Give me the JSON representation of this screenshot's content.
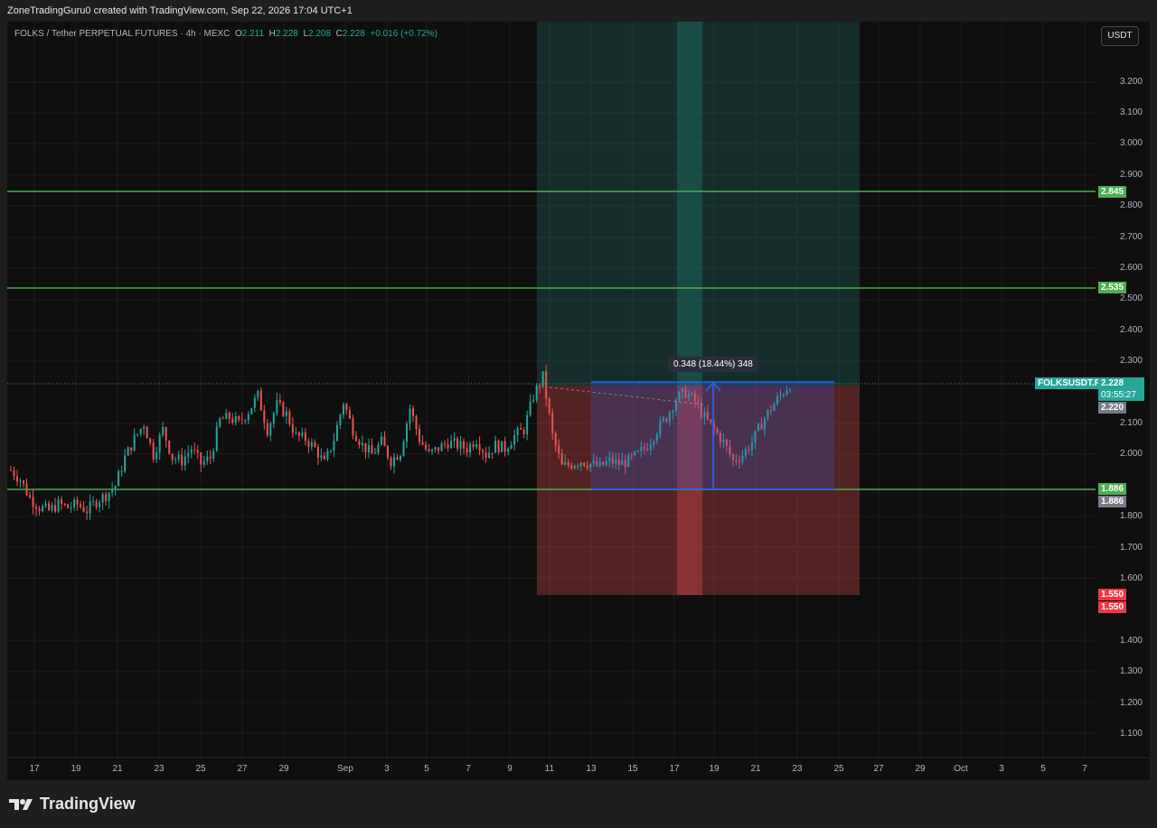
{
  "header": {
    "credit": "ZoneTradingGuru0 created with TradingView.com, Sep 22, 2026 17:04 UTC+1"
  },
  "legend": {
    "symbol": "FOLKS / Tether PERPETUAL FUTURES · 4h · MEXC",
    "o_key": "O",
    "o_val": "2.211",
    "h_key": "H",
    "h_val": "2.228",
    "l_key": "L",
    "l_val": "2.208",
    "c_key": "C",
    "c_val": "2.228",
    "change": "+0.016 (+0.72%)"
  },
  "currency_button": "USDT",
  "price_axis": [
    "3.200",
    "3.100",
    "3.000",
    "2.900",
    "2.800",
    "2.700",
    "2.600",
    "2.500",
    "2.400",
    "2.300",
    "2.100",
    "2.000",
    "1.800",
    "1.700",
    "1.600",
    "1.400",
    "1.300",
    "1.200",
    "1.100"
  ],
  "time_axis": [
    "17",
    "19",
    "21",
    "23",
    "25",
    "27",
    "29",
    "Sep",
    "3",
    "5",
    "7",
    "9",
    "11",
    "13",
    "15",
    "17",
    "19",
    "21",
    "23",
    "25",
    "27",
    "29",
    "Oct",
    "3",
    "5",
    "7"
  ],
  "tags": {
    "level_2845": "2.845",
    "level_2535": "2.535",
    "symbol_tag": "FOLKSUSDT.P",
    "last_price": "2.228",
    "countdown": "03:55:27",
    "prev_price": "2.220",
    "level_1886_a": "1.886",
    "level_1886_b": "1.886",
    "stop_a": "1.550",
    "stop_b": "1.550"
  },
  "measure_label": "0.348 (18.44%) 348",
  "footer": {
    "brand": "TradingView"
  },
  "colors": {
    "up": "#26a69a",
    "down": "#ef5350",
    "level": "#4caf50",
    "measure": "#2962ff"
  },
  "chart_data": {
    "type": "candlestick",
    "price_range": [
      1.02,
      3.33
    ],
    "levels": [
      2.845,
      2.535,
      1.886
    ],
    "position": {
      "entry": 2.228,
      "target": 3.33,
      "stop": 1.55
    },
    "measurement": {
      "from": 1.886,
      "to": 2.234,
      "delta": 0.348,
      "percent": 18.44
    },
    "close_path": [
      1.95,
      1.92,
      1.86,
      1.83,
      1.82,
      1.84,
      1.83,
      1.84,
      1.82,
      1.85,
      1.87,
      1.9,
      1.99,
      2.05,
      2.1,
      2.0,
      2.08,
      1.99,
      1.98,
      2.02,
      1.97,
      1.99,
      2.11,
      2.12,
      2.1,
      2.14,
      2.19,
      2.08,
      2.16,
      2.13,
      2.06,
      2.05,
      2.02,
      1.97,
      2.05,
      2.17,
      2.08,
      2.03,
      2.0,
      2.04,
      1.98,
      2.01,
      2.15,
      2.05,
      2.0,
      2.02,
      2.04,
      2.03,
      2.02,
      2.05,
      2.0,
      2.03,
      2.02,
      2.06,
      2.08,
      2.19,
      2.25,
      2.06,
      1.96,
      1.97,
      1.98,
      1.97,
      1.96,
      1.98,
      1.97,
      1.98,
      2.0,
      2.03,
      2.08,
      2.12,
      2.18,
      2.2,
      2.17,
      2.12,
      2.08,
      2.04,
      1.98,
      2.0,
      2.04,
      2.1,
      2.15,
      2.19,
      2.228
    ]
  }
}
